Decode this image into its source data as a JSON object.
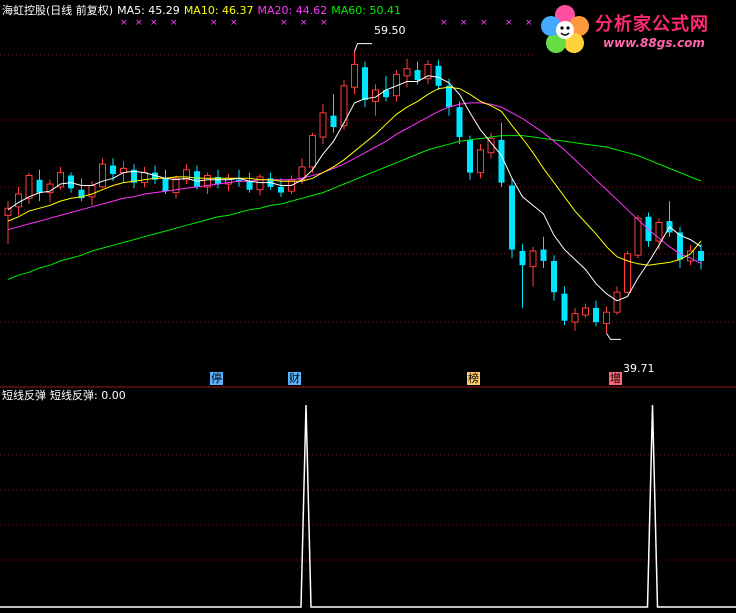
{
  "header": {
    "title": "海虹控股(日线 前复权)",
    "ma5": "MA5: 45.29",
    "ma10": "MA10: 46.37",
    "ma20": "MA20: 44.62",
    "ma60": "MA60: 50.41"
  },
  "price_labels": {
    "high": "59.50",
    "low": "39.71"
  },
  "event_tags": [
    {
      "text": "停",
      "color": "#5ab4ff"
    },
    {
      "text": "财",
      "color": "#5ab4ff"
    },
    {
      "text": "榜",
      "color": "#ffcc66"
    },
    {
      "text": "增",
      "color": "#ff6677"
    }
  ],
  "indicator": {
    "name": "短线反弹",
    "value_text": "短线反弹: 0.00"
  },
  "watermark": {
    "name": "分析家公式网",
    "url": "www.88gs.com"
  },
  "colors": {
    "up": "#ff3c3c",
    "down": "#00e5ff",
    "ma5": "#ffffff",
    "ma10": "#ffff00",
    "ma20": "#ff33ff",
    "ma60": "#00ee00",
    "grid": "#7a1a1a"
  },
  "chart_data": {
    "type": "candlestick",
    "ylim": [
      37,
      62
    ],
    "ohlc": [
      [
        48,
        49,
        46,
        48.5
      ],
      [
        48.6,
        50,
        48,
        49.5
      ],
      [
        49.2,
        51,
        48.8,
        50.8
      ],
      [
        50.5,
        51.2,
        49,
        49.6
      ],
      [
        49.6,
        50.5,
        48.9,
        50.2
      ],
      [
        50,
        51.4,
        49.8,
        51
      ],
      [
        50.8,
        51,
        49.6,
        49.9
      ],
      [
        49.8,
        50.6,
        49,
        49.2
      ],
      [
        49.3,
        50.4,
        48.7,
        50.1
      ],
      [
        50,
        52,
        49.9,
        51.6
      ],
      [
        51.5,
        52,
        50.4,
        50.9
      ],
      [
        51,
        51.8,
        50.3,
        51.3
      ],
      [
        51.2,
        51.6,
        49.9,
        50.3
      ],
      [
        50.3,
        51.4,
        50,
        51
      ],
      [
        51,
        51.5,
        50.2,
        50.5
      ],
      [
        50.6,
        51.2,
        49.5,
        49.7
      ],
      [
        49.6,
        50.8,
        49.2,
        50.6
      ],
      [
        50.5,
        51.6,
        50.2,
        51.2
      ],
      [
        51.1,
        51.5,
        49.8,
        50
      ],
      [
        50,
        51,
        49.5,
        50.8
      ],
      [
        50.7,
        51.2,
        49.9,
        50.2
      ],
      [
        50.2,
        50.9,
        49.7,
        50.6
      ],
      [
        50.5,
        51.2,
        50,
        50.4
      ],
      [
        50.4,
        51,
        49.6,
        49.8
      ],
      [
        49.8,
        50.9,
        49.4,
        50.7
      ],
      [
        50.6,
        51,
        49.8,
        50
      ],
      [
        50,
        50.6,
        49.3,
        49.6
      ],
      [
        49.7,
        50.8,
        49.5,
        50.5
      ],
      [
        50.5,
        52,
        50.2,
        51.4
      ],
      [
        51.4,
        53.8,
        51,
        53.6
      ],
      [
        53.5,
        55.8,
        53,
        55.2
      ],
      [
        55,
        56.5,
        53.8,
        54.2
      ],
      [
        54.3,
        57.5,
        54,
        57.1
      ],
      [
        57,
        59.5,
        56.5,
        58.6
      ],
      [
        58.4,
        58.8,
        55.6,
        56.1
      ],
      [
        56,
        57.2,
        55,
        56.8
      ],
      [
        56.8,
        57.8,
        56,
        56.3
      ],
      [
        56.4,
        58.2,
        56,
        57.9
      ],
      [
        57.8,
        59,
        57,
        58.3
      ],
      [
        58.2,
        58.8,
        57.2,
        57.5
      ],
      [
        57.6,
        58.9,
        57.2,
        58.6
      ],
      [
        58.5,
        58.9,
        56.8,
        57.1
      ],
      [
        57.1,
        57.6,
        55,
        55.6
      ],
      [
        55.6,
        56,
        53,
        53.5
      ],
      [
        53.3,
        53.6,
        50.5,
        51
      ],
      [
        51,
        53,
        50.6,
        52.6
      ],
      [
        52.4,
        53.8,
        52,
        53.4
      ],
      [
        53.3,
        54.5,
        50,
        50.3
      ],
      [
        50.1,
        50.6,
        45,
        45.6
      ],
      [
        45.5,
        46,
        41.5,
        44.5
      ],
      [
        44.4,
        45.8,
        43,
        45.5
      ],
      [
        45.6,
        46.5,
        44.3,
        44.8
      ],
      [
        44.8,
        45.2,
        42,
        42.6
      ],
      [
        42.5,
        43,
        40.3,
        40.6
      ],
      [
        40.5,
        41.5,
        39.9,
        41.1
      ],
      [
        41,
        41.8,
        40.8,
        41.5
      ],
      [
        41.5,
        42,
        40.2,
        40.5
      ],
      [
        40.4,
        41.6,
        39.71,
        41.2
      ],
      [
        41.2,
        43,
        41,
        42.6
      ],
      [
        42.6,
        45.5,
        42.5,
        45.3
      ],
      [
        45.2,
        48,
        45,
        47.8
      ],
      [
        47.9,
        48.2,
        45.8,
        46.2
      ],
      [
        46.2,
        47.8,
        45.6,
        47.5
      ],
      [
        47.6,
        49,
        46.5,
        46.8
      ],
      [
        46.8,
        47.2,
        44.3,
        44.9
      ],
      [
        44.8,
        45.9,
        44.5,
        45.5
      ],
      [
        45.5,
        46,
        44.2,
        44.8
      ]
    ],
    "ma5": [
      48.4,
      48.9,
      49.3,
      49.6,
      49.7,
      50.2,
      50.3,
      50.1,
      50.1,
      50.4,
      50.6,
      51,
      51.1,
      51,
      50.8,
      50.6,
      50.5,
      50.6,
      50.4,
      50.5,
      50.5,
      50.5,
      50.6,
      50.4,
      50.3,
      50.3,
      50.1,
      50.1,
      50.5,
      51.2,
      52.3,
      53.2,
      54.5,
      55.9,
      56.2,
      56.3,
      56.8,
      57.1,
      57.4,
      57.4,
      57.8,
      57.7,
      57.3,
      56.5,
      55.2,
      54,
      53.1,
      52.2,
      50.6,
      49.3,
      48.7,
      48.1,
      46.6,
      45.6,
      44.9,
      44.2,
      43.2,
      42.5,
      42,
      42.3,
      43.6,
      44.7,
      45.9,
      47.2,
      46.6,
      46.3,
      45.8
    ],
    "ma10": [
      47.6,
      47.9,
      48.3,
      48.5,
      48.7,
      49,
      49.2,
      49.3,
      49.5,
      49.8,
      50.1,
      50.3,
      50.4,
      50.5,
      50.6,
      50.6,
      50.7,
      50.7,
      50.6,
      50.6,
      50.6,
      50.6,
      50.6,
      50.6,
      50.5,
      50.5,
      50.4,
      50.4,
      50.4,
      50.6,
      51,
      51.4,
      51.9,
      52.5,
      53.1,
      53.7,
      54.4,
      55.1,
      55.6,
      56,
      56.5,
      56.9,
      57,
      56.9,
      56.5,
      56,
      55.7,
      55.3,
      54.3,
      53.4,
      52.4,
      51.3,
      50.3,
      49.3,
      48.3,
      47.5,
      46.7,
      45.8,
      45.1,
      44.8,
      44.6,
      44.5,
      44.6,
      44.7,
      44.9,
      45.3,
      46.2
    ],
    "ma20": [
      47,
      47.2,
      47.4,
      47.6,
      47.8,
      48,
      48.2,
      48.4,
      48.6,
      48.8,
      49,
      49.2,
      49.3,
      49.5,
      49.6,
      49.7,
      49.8,
      49.9,
      50,
      50.1,
      50.2,
      50.3,
      50.4,
      50.4,
      50.5,
      50.5,
      50.5,
      50.5,
      50.6,
      50.8,
      51,
      51.3,
      51.6,
      52,
      52.4,
      52.8,
      53.2,
      53.7,
      54.1,
      54.5,
      54.9,
      55.3,
      55.6,
      55.8,
      55.9,
      55.9,
      55.8,
      55.6,
      55.2,
      54.8,
      54.3,
      53.8,
      53.2,
      52.6,
      51.9,
      51.2,
      50.5,
      49.8,
      49.1,
      48.4,
      47.7,
      47,
      46.4,
      45.8,
      45.3,
      45,
      44.62
    ],
    "ma60": [
      43.5,
      43.8,
      44,
      44.3,
      44.5,
      44.8,
      45,
      45.2,
      45.5,
      45.7,
      45.9,
      46.1,
      46.3,
      46.5,
      46.7,
      46.9,
      47.1,
      47.3,
      47.5,
      47.7,
      47.9,
      48,
      48.2,
      48.4,
      48.5,
      48.7,
      48.8,
      49,
      49.2,
      49.4,
      49.6,
      49.9,
      50.2,
      50.5,
      50.8,
      51.1,
      51.4,
      51.7,
      52,
      52.3,
      52.6,
      52.8,
      53,
      53.2,
      53.3,
      53.4,
      53.5,
      53.6,
      53.6,
      53.6,
      53.5,
      53.4,
      53.3,
      53.2,
      53.1,
      53,
      52.9,
      52.8,
      52.6,
      52.4,
      52.2,
      51.9,
      51.6,
      51.3,
      51,
      50.7,
      50.41
    ],
    "signal_spikes": [
      28,
      61
    ]
  }
}
